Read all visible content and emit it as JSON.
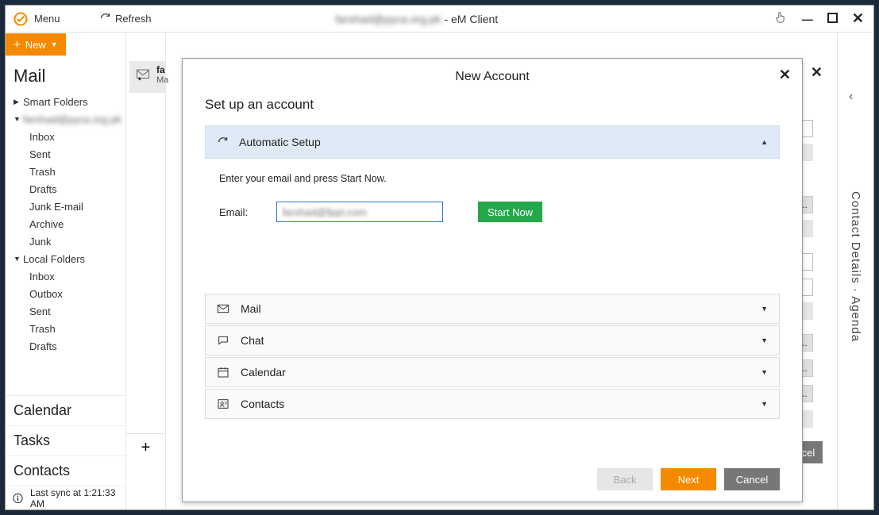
{
  "titlebar": {
    "menu": "Menu",
    "account_blur": "farshad@pyca.org.pk",
    "suffix": " - eM Client"
  },
  "toolbar": {
    "new": "New",
    "refresh": "Refresh"
  },
  "sidebar": {
    "mail": "Mail",
    "smart": "Smart Folders",
    "account_blur": "farshad@pyca.org.pk",
    "folders": [
      "Inbox",
      "Sent",
      "Trash",
      "Drafts",
      "Junk E-mail",
      "Archive",
      "Junk"
    ],
    "local_label": "Local Folders",
    "local": [
      "Inbox",
      "Outbox",
      "Sent",
      "Trash",
      "Drafts"
    ],
    "calendar": "Calendar",
    "tasks": "Tasks",
    "contacts": "Contacts",
    "sync": "Last sync at 1:21:33 AM"
  },
  "msg": {
    "sender": "fa",
    "sub": "Ma"
  },
  "plus": "+",
  "background_buttons": {
    "s": "s...",
    "t": "t...",
    "cancel": "Cancel"
  },
  "rightbar": {
    "chev": "‹",
    "label": "Contact Details  ·  Agenda"
  },
  "dialog": {
    "title": "New Account",
    "setup": "Set up an account",
    "auto": "Automatic Setup",
    "enter": "Enter your email and press Start Now.",
    "email_label": "Email:",
    "email_value": "farshad@fppt.com",
    "start": "Start Now",
    "categories": [
      "Mail",
      "Chat",
      "Calendar",
      "Contacts"
    ],
    "back": "Back",
    "next": "Next",
    "cancel": "Cancel"
  }
}
